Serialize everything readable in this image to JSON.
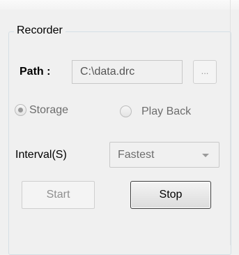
{
  "recorder": {
    "title": "Recorder",
    "path_label": "Path :",
    "path_value": "C:\\data.drc",
    "browse_label": "...",
    "mode_storage_label": "Storage",
    "mode_storage_selected": true,
    "mode_playback_label": "Play Back",
    "mode_playback_selected": false,
    "interval_label": "Interval(S)",
    "interval_value": "Fastest",
    "start_label": "Start",
    "stop_label": "Stop"
  }
}
